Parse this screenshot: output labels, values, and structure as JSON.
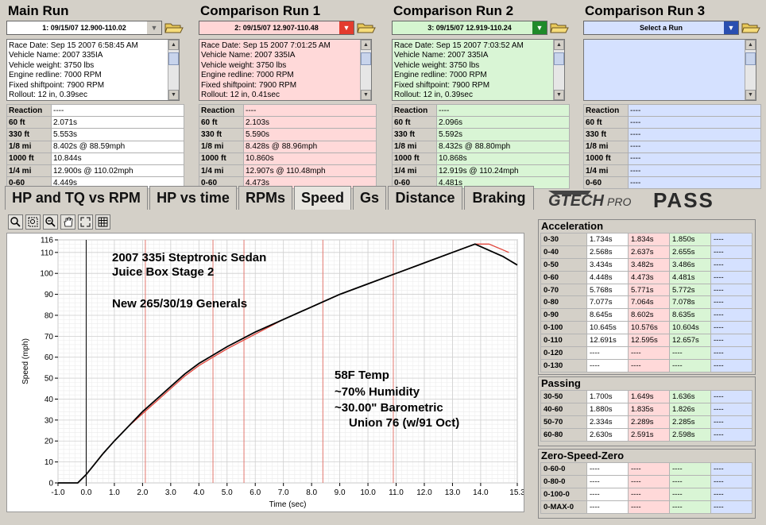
{
  "runs": [
    {
      "title": "Main Run",
      "select": "1:  09/15/07 12.900-110.02",
      "select_color": "#ffffff",
      "arrow_color": "#d4d0c8",
      "arrow_fg": "#666666",
      "box_color": "#ffffff",
      "info": [
        "Race Date: Sep 15 2007  6:58:45 AM",
        "Vehicle Name: 2007 335IA",
        "Vehicle weight: 3750 lbs",
        "Engine redline: 7000 RPM",
        "Fixed shiftpoint: 7900 RPM",
        "Rollout: 12 in, 0.39sec"
      ],
      "stats": [
        [
          "Reaction",
          "----"
        ],
        [
          "60 ft",
          "2.071s"
        ],
        [
          "330 ft",
          "5.553s"
        ],
        [
          "1/8 mi",
          "8.402s @ 88.59mph"
        ],
        [
          "1000 ft",
          "10.844s"
        ],
        [
          "1/4 mi",
          "12.900s @ 110.02mph"
        ],
        [
          "0-60",
          "4.449s"
        ]
      ]
    },
    {
      "title": "Comparison Run 1",
      "select": "2:  09/15/07 12.907-110.48",
      "select_color": "#ffd6d6",
      "arrow_color": "#e33b2e",
      "arrow_fg": "#ffffff",
      "box_color": "#ffd9d9",
      "info": [
        "Race Date: Sep 15 2007  7:01:25 AM",
        "Vehicle Name: 2007 335IA",
        "Vehicle weight: 3750 lbs",
        "Engine redline: 7000 RPM",
        "Fixed shiftpoint: 7900 RPM",
        "Rollout: 12 in, 0.41sec"
      ],
      "stats": [
        [
          "Reaction",
          "----"
        ],
        [
          "60 ft",
          "2.103s"
        ],
        [
          "330 ft",
          "5.590s"
        ],
        [
          "1/8 mi",
          "8.428s @ 88.96mph"
        ],
        [
          "1000 ft",
          "10.860s"
        ],
        [
          "1/4 mi",
          "12.907s @ 110.48mph"
        ],
        [
          "0-60",
          "4.473s"
        ]
      ]
    },
    {
      "title": "Comparison Run 2",
      "select": "3:  09/15/07 12.919-110.24",
      "select_color": "#d5f5d0",
      "arrow_color": "#1f8a2a",
      "arrow_fg": "#ffffff",
      "box_color": "#d9f5d5",
      "info": [
        "Race Date: Sep 15 2007  7:03:52 AM",
        "Vehicle Name: 2007 335IA",
        "Vehicle weight: 3750 lbs",
        "Engine redline: 7000 RPM",
        "Fixed shiftpoint: 7900 RPM",
        "Rollout: 12 in, 0.39sec"
      ],
      "stats": [
        [
          "Reaction",
          "----"
        ],
        [
          "60 ft",
          "2.096s"
        ],
        [
          "330 ft",
          "5.592s"
        ],
        [
          "1/8 mi",
          "8.432s @ 88.80mph"
        ],
        [
          "1000 ft",
          "10.868s"
        ],
        [
          "1/4 mi",
          "12.919s @ 110.24mph"
        ],
        [
          "0-60",
          "4.481s"
        ]
      ]
    },
    {
      "title": "Comparison Run 3",
      "select": "Select a Run",
      "select_color": "#d5e1ff",
      "arrow_color": "#2a4fb0",
      "arrow_fg": "#ffffff",
      "box_color": "#d5e1ff",
      "info": [],
      "stats": [
        [
          "Reaction",
          "----"
        ],
        [
          "60 ft",
          "----"
        ],
        [
          "330 ft",
          "----"
        ],
        [
          "1/8 mi",
          "----"
        ],
        [
          "1000 ft",
          "----"
        ],
        [
          "1/4 mi",
          "----"
        ],
        [
          "0-60",
          "----"
        ]
      ]
    }
  ],
  "tabs": [
    {
      "label": "HP and TQ vs RPM",
      "active": false
    },
    {
      "label": "HP vs time",
      "active": false
    },
    {
      "label": "RPMs",
      "active": false
    },
    {
      "label": "Speed",
      "active": true
    },
    {
      "label": "Gs",
      "active": false
    },
    {
      "label": "Distance",
      "active": false
    },
    {
      "label": "Braking",
      "active": false
    }
  ],
  "logo": {
    "brand": "GTECH",
    "sub": "PRO",
    "product": "PASS"
  },
  "toolbar": [
    "zoom-icon",
    "zoom-region-icon",
    "zoom-out-icon",
    "pan-hand-icon",
    "fit-icon",
    "grid-icon"
  ],
  "chart_notes": {
    "line1": "2007 335i Steptronic Sedan",
    "line2": "Juice Box Stage 2",
    "line3": "New 265/30/19 Generals",
    "line4": "58F Temp",
    "line5": "~70% Humidity",
    "line6": "~30.00\" Barometric",
    "line7": "Union 76 (w/91 Oct)"
  },
  "chart_data": {
    "type": "line",
    "xlabel": "Time (sec)",
    "ylabel": "Speed (mph)",
    "xlim": [
      -1.0,
      15.3
    ],
    "ylim": [
      0,
      116
    ],
    "xticks": [
      "-1.0",
      "0.0",
      "1.0",
      "2.0",
      "3.0",
      "4.0",
      "5.0",
      "6.0",
      "7.0",
      "8.0",
      "9.0",
      "10.0",
      "11.0",
      "12.0",
      "13.0",
      "14.0",
      "15.3"
    ],
    "yticks": [
      "0",
      "10",
      "20",
      "30",
      "40",
      "50",
      "60",
      "70",
      "80",
      "90",
      "100",
      "110",
      "116"
    ],
    "shift_lines_red": [
      2.1,
      4.5,
      5.6,
      8.4,
      10.9
    ],
    "series": [
      {
        "color": "#000000",
        "x": [
          -1.0,
          -0.3,
          0,
          0.3,
          0.6,
          1.0,
          1.5,
          2.0,
          2.5,
          3.0,
          3.5,
          4.0,
          4.5,
          5.0,
          6.0,
          7.0,
          8.0,
          9.0,
          10.0,
          11.0,
          12.0,
          13.0,
          13.8,
          14.3,
          14.8,
          15.3
        ],
        "y": [
          0,
          0,
          4,
          9,
          14,
          20,
          27,
          34,
          40,
          46,
          52,
          57,
          61,
          65,
          72,
          78,
          84,
          90,
          95,
          100,
          105,
          110,
          114,
          111,
          108,
          104
        ]
      },
      {
        "color": "#e0443a",
        "x": [
          -0.3,
          0,
          0.3,
          0.6,
          1.0,
          1.5,
          2.0,
          2.5,
          3.0,
          3.5,
          4.0,
          4.5,
          5.0,
          6.0,
          7.0,
          8.0,
          9.0,
          10.0,
          11.0,
          12.0,
          13.0,
          13.8,
          14.3,
          15.0
        ],
        "y": [
          0,
          4,
          9,
          14,
          20,
          27,
          33,
          39,
          45,
          51,
          56,
          60,
          64,
          71,
          78,
          84,
          90,
          95,
          100,
          105,
          110,
          114,
          114,
          110
        ]
      }
    ]
  },
  "accel": {
    "title": "Acceleration",
    "rows": [
      [
        "0-30",
        "1.734s",
        "1.834s",
        "1.850s",
        "----"
      ],
      [
        "0-40",
        "2.568s",
        "2.637s",
        "2.655s",
        "----"
      ],
      [
        "0-50",
        "3.434s",
        "3.482s",
        "3.486s",
        "----"
      ],
      [
        "0-60",
        "4.448s",
        "4.473s",
        "4.481s",
        "----"
      ],
      [
        "0-70",
        "5.768s",
        "5.771s",
        "5.772s",
        "----"
      ],
      [
        "0-80",
        "7.077s",
        "7.064s",
        "7.078s",
        "----"
      ],
      [
        "0-90",
        "8.645s",
        "8.602s",
        "8.635s",
        "----"
      ],
      [
        "0-100",
        "10.645s",
        "10.576s",
        "10.604s",
        "----"
      ],
      [
        "0-110",
        "12.691s",
        "12.595s",
        "12.657s",
        "----"
      ],
      [
        "0-120",
        "----",
        "----",
        "----",
        "----"
      ],
      [
        "0-130",
        "----",
        "----",
        "----",
        "----"
      ]
    ]
  },
  "passing": {
    "title": "Passing",
    "rows": [
      [
        "30-50",
        "1.700s",
        "1.649s",
        "1.636s",
        "----"
      ],
      [
        "40-60",
        "1.880s",
        "1.835s",
        "1.826s",
        "----"
      ],
      [
        "50-70",
        "2.334s",
        "2.289s",
        "2.285s",
        "----"
      ],
      [
        "60-80",
        "2.630s",
        "2.591s",
        "2.598s",
        "----"
      ]
    ]
  },
  "zsz": {
    "title": "Zero-Speed-Zero",
    "rows": [
      [
        "0-60-0",
        "----",
        "----",
        "----",
        "----"
      ],
      [
        "0-80-0",
        "----",
        "----",
        "----",
        "----"
      ],
      [
        "0-100-0",
        "----",
        "----",
        "----",
        "----"
      ],
      [
        "0-MAX-0",
        "----",
        "----",
        "----",
        "----"
      ]
    ]
  }
}
